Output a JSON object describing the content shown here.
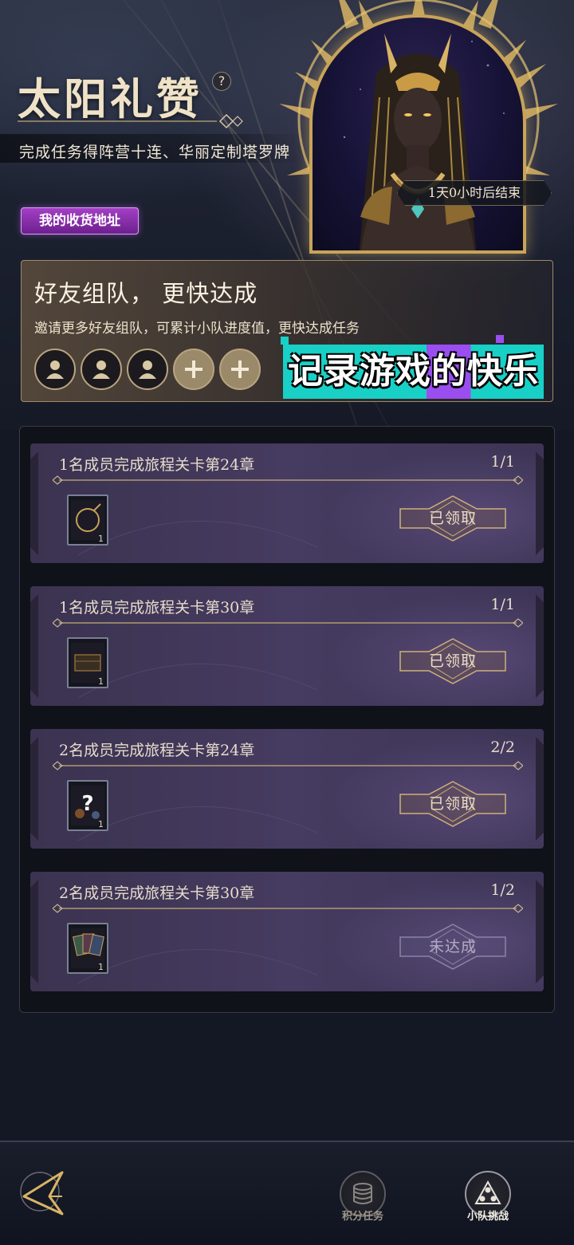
{
  "header": {
    "title": "太阳礼赞",
    "help_icon": "?",
    "subtitle": "完成任务得阵营十连、华丽定制塔罗牌",
    "timer": "1天0小时后结束",
    "address_button": "我的收货地址"
  },
  "team": {
    "title": "好友组队，  更快达成",
    "description": "邀请更多好友组队，可累计小队进度值，更快达成任务",
    "slots": [
      {
        "state": "filled",
        "icon": "user-icon"
      },
      {
        "state": "filled",
        "icon": "user-icon"
      },
      {
        "state": "filled",
        "icon": "user-icon"
      },
      {
        "state": "empty",
        "icon": "plus-icon"
      },
      {
        "state": "empty",
        "icon": "plus-icon"
      }
    ]
  },
  "watermark": "记录游戏的快乐",
  "tasks": [
    {
      "name": "1名成员完成旅程关卡第24章",
      "progress": "1/1",
      "reward_count": "1",
      "status": "已领取",
      "reward_icon": "ring-card-icon"
    },
    {
      "name": "1名成员完成旅程关卡第30章",
      "progress": "1/1",
      "reward_count": "1",
      "status": "已领取",
      "reward_icon": "chest-card-icon"
    },
    {
      "name": "2名成员完成旅程关卡第24章",
      "progress": "2/2",
      "reward_count": "1",
      "status": "已领取",
      "reward_icon": "mystery-card-icon"
    },
    {
      "name": "2名成员完成旅程关卡第30章",
      "progress": "1/2",
      "reward_count": "1",
      "status": "未达成",
      "reward_icon": "tarot-cards-icon"
    }
  ],
  "nav": {
    "back_icon": "back-arrow-icon",
    "tabs": [
      {
        "label": "积分任务",
        "icon": "coin-stack-icon",
        "active": false
      },
      {
        "label": "小队挑战",
        "icon": "team-icon",
        "active": true
      }
    ]
  },
  "colors": {
    "accent_gold": "#c8a458",
    "address_button": "#a340c4",
    "card_purple": "#463b60",
    "watermark_cyan": "#18d0c6",
    "watermark_purple": "#9a4ef0"
  }
}
